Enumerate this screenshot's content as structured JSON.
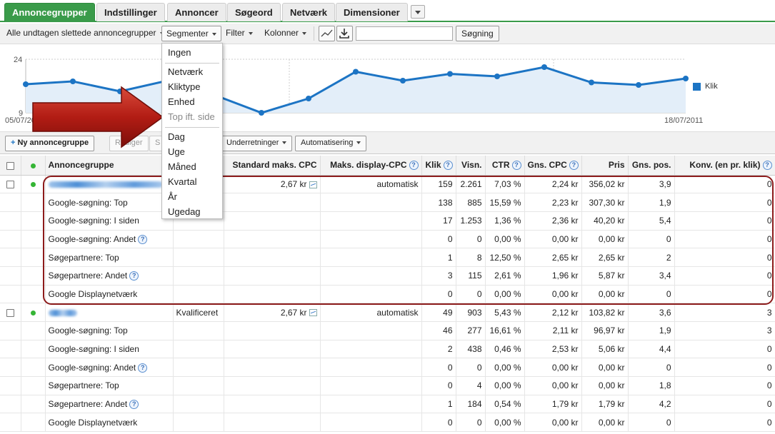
{
  "tabs": [
    "Annoncegrupper",
    "Indstillinger",
    "Annoncer",
    "Søgeord",
    "Netværk",
    "Dimensioner"
  ],
  "toolbar": {
    "filter_all": "Alle undtagen slettede annoncegrupper",
    "segments": "Segmenter",
    "filter": "Filter",
    "columns": "Kolonner",
    "search_value": "",
    "search_button": "Søgning"
  },
  "chart": {
    "y_max": "24",
    "y_min": "9",
    "x_start": "05/07/2011",
    "x_end": "18/07/2011",
    "legend": "Klik",
    "series_color": "#1c74c4",
    "values": [
      17,
      17.8,
      15,
      18,
      14,
      9,
      13,
      20.5,
      18,
      19.9,
      19.2,
      21.8,
      17.5,
      16.8,
      18.6
    ]
  },
  "actions": {
    "new_group": "Ny annoncegruppe",
    "edit": "Rediger",
    "status": "S",
    "details": "Underretninger",
    "automation": "Automatisering"
  },
  "table": {
    "headers": {
      "group": "Annoncegruppe",
      "status": "",
      "std_cpc": "Standard maks. CPC",
      "display_cpc": "Maks. display-CPC",
      "clicks": "Klik",
      "impr": "Visn.",
      "ctr": "CTR",
      "avg_cpc": "Gns. CPC",
      "cost": "Pris",
      "avg_pos": "Gns. pos.",
      "conv": "Konv. (en pr. klik)"
    },
    "rows": [
      {
        "name": "",
        "status": "",
        "std_cpc": "2,67 kr",
        "display_cpc": "automatisk",
        "clicks": "159",
        "impr": "2.261",
        "ctr": "7,03 %",
        "avg_cpc": "2,24 kr",
        "cost": "356,02 kr",
        "avg_pos": "3,9",
        "conv": "0"
      },
      {
        "name": "Google-søgning: Top",
        "clicks": "138",
        "impr": "885",
        "ctr": "15,59 %",
        "avg_cpc": "2,23 kr",
        "cost": "307,30 kr",
        "avg_pos": "1,9",
        "conv": "0"
      },
      {
        "name": "Google-søgning: I siden",
        "clicks": "17",
        "impr": "1.253",
        "ctr": "1,36 %",
        "avg_cpc": "2,36 kr",
        "cost": "40,20 kr",
        "avg_pos": "5,4",
        "conv": "0"
      },
      {
        "name": "Google-søgning: Andet",
        "clicks": "0",
        "impr": "0",
        "ctr": "0,00 %",
        "avg_cpc": "0,00 kr",
        "cost": "0,00 kr",
        "avg_pos": "0",
        "conv": "0"
      },
      {
        "name": "Søgepartnere: Top",
        "clicks": "1",
        "impr": "8",
        "ctr": "12,50 %",
        "avg_cpc": "2,65 kr",
        "cost": "2,65 kr",
        "avg_pos": "2",
        "conv": "0"
      },
      {
        "name": "Søgepartnere: Andet",
        "clicks": "3",
        "impr": "115",
        "ctr": "2,61 %",
        "avg_cpc": "1,96 kr",
        "cost": "5,87 kr",
        "avg_pos": "3,4",
        "conv": "0"
      },
      {
        "name": "Google Displaynetværk",
        "clicks": "0",
        "impr": "0",
        "ctr": "0,00 %",
        "avg_cpc": "0,00 kr",
        "cost": "0,00 kr",
        "avg_pos": "0",
        "conv": "0"
      },
      {
        "name": "",
        "status": "Kvalificeret",
        "std_cpc": "2,67 kr",
        "display_cpc": "automatisk",
        "clicks": "49",
        "impr": "903",
        "ctr": "5,43 %",
        "avg_cpc": "2,12 kr",
        "cost": "103,82 kr",
        "avg_pos": "3,6",
        "conv": "3"
      },
      {
        "name": "Google-søgning: Top",
        "clicks": "46",
        "impr": "277",
        "ctr": "16,61 %",
        "avg_cpc": "2,11 kr",
        "cost": "96,97 kr",
        "avg_pos": "1,9",
        "conv": "3"
      },
      {
        "name": "Google-søgning: I siden",
        "clicks": "2",
        "impr": "438",
        "ctr": "0,46 %",
        "avg_cpc": "2,53 kr",
        "cost": "5,06 kr",
        "avg_pos": "4,4",
        "conv": "0"
      },
      {
        "name": "Google-søgning: Andet",
        "clicks": "0",
        "impr": "0",
        "ctr": "0,00 %",
        "avg_cpc": "0,00 kr",
        "cost": "0,00 kr",
        "avg_pos": "0",
        "conv": "0"
      },
      {
        "name": "Søgepartnere: Top",
        "clicks": "0",
        "impr": "4",
        "ctr": "0,00 %",
        "avg_cpc": "0,00 kr",
        "cost": "0,00 kr",
        "avg_pos": "1,8",
        "conv": "0"
      },
      {
        "name": "Søgepartnere: Andet",
        "clicks": "1",
        "impr": "184",
        "ctr": "0,54 %",
        "avg_cpc": "1,79 kr",
        "cost": "1,79 kr",
        "avg_pos": "4,2",
        "conv": "0"
      },
      {
        "name": "Google Displaynetværk",
        "clicks": "0",
        "impr": "0",
        "ctr": "0,00 %",
        "avg_cpc": "0,00 kr",
        "cost": "0,00 kr",
        "avg_pos": "0",
        "conv": "0"
      }
    ]
  },
  "dropdown": {
    "items": [
      "Ingen",
      "Netværk",
      "Kliktype",
      "Enhed",
      "Top ift. side",
      "Dag",
      "Uge",
      "Måned",
      "Kvartal",
      "År",
      "Ugedag"
    ]
  }
}
